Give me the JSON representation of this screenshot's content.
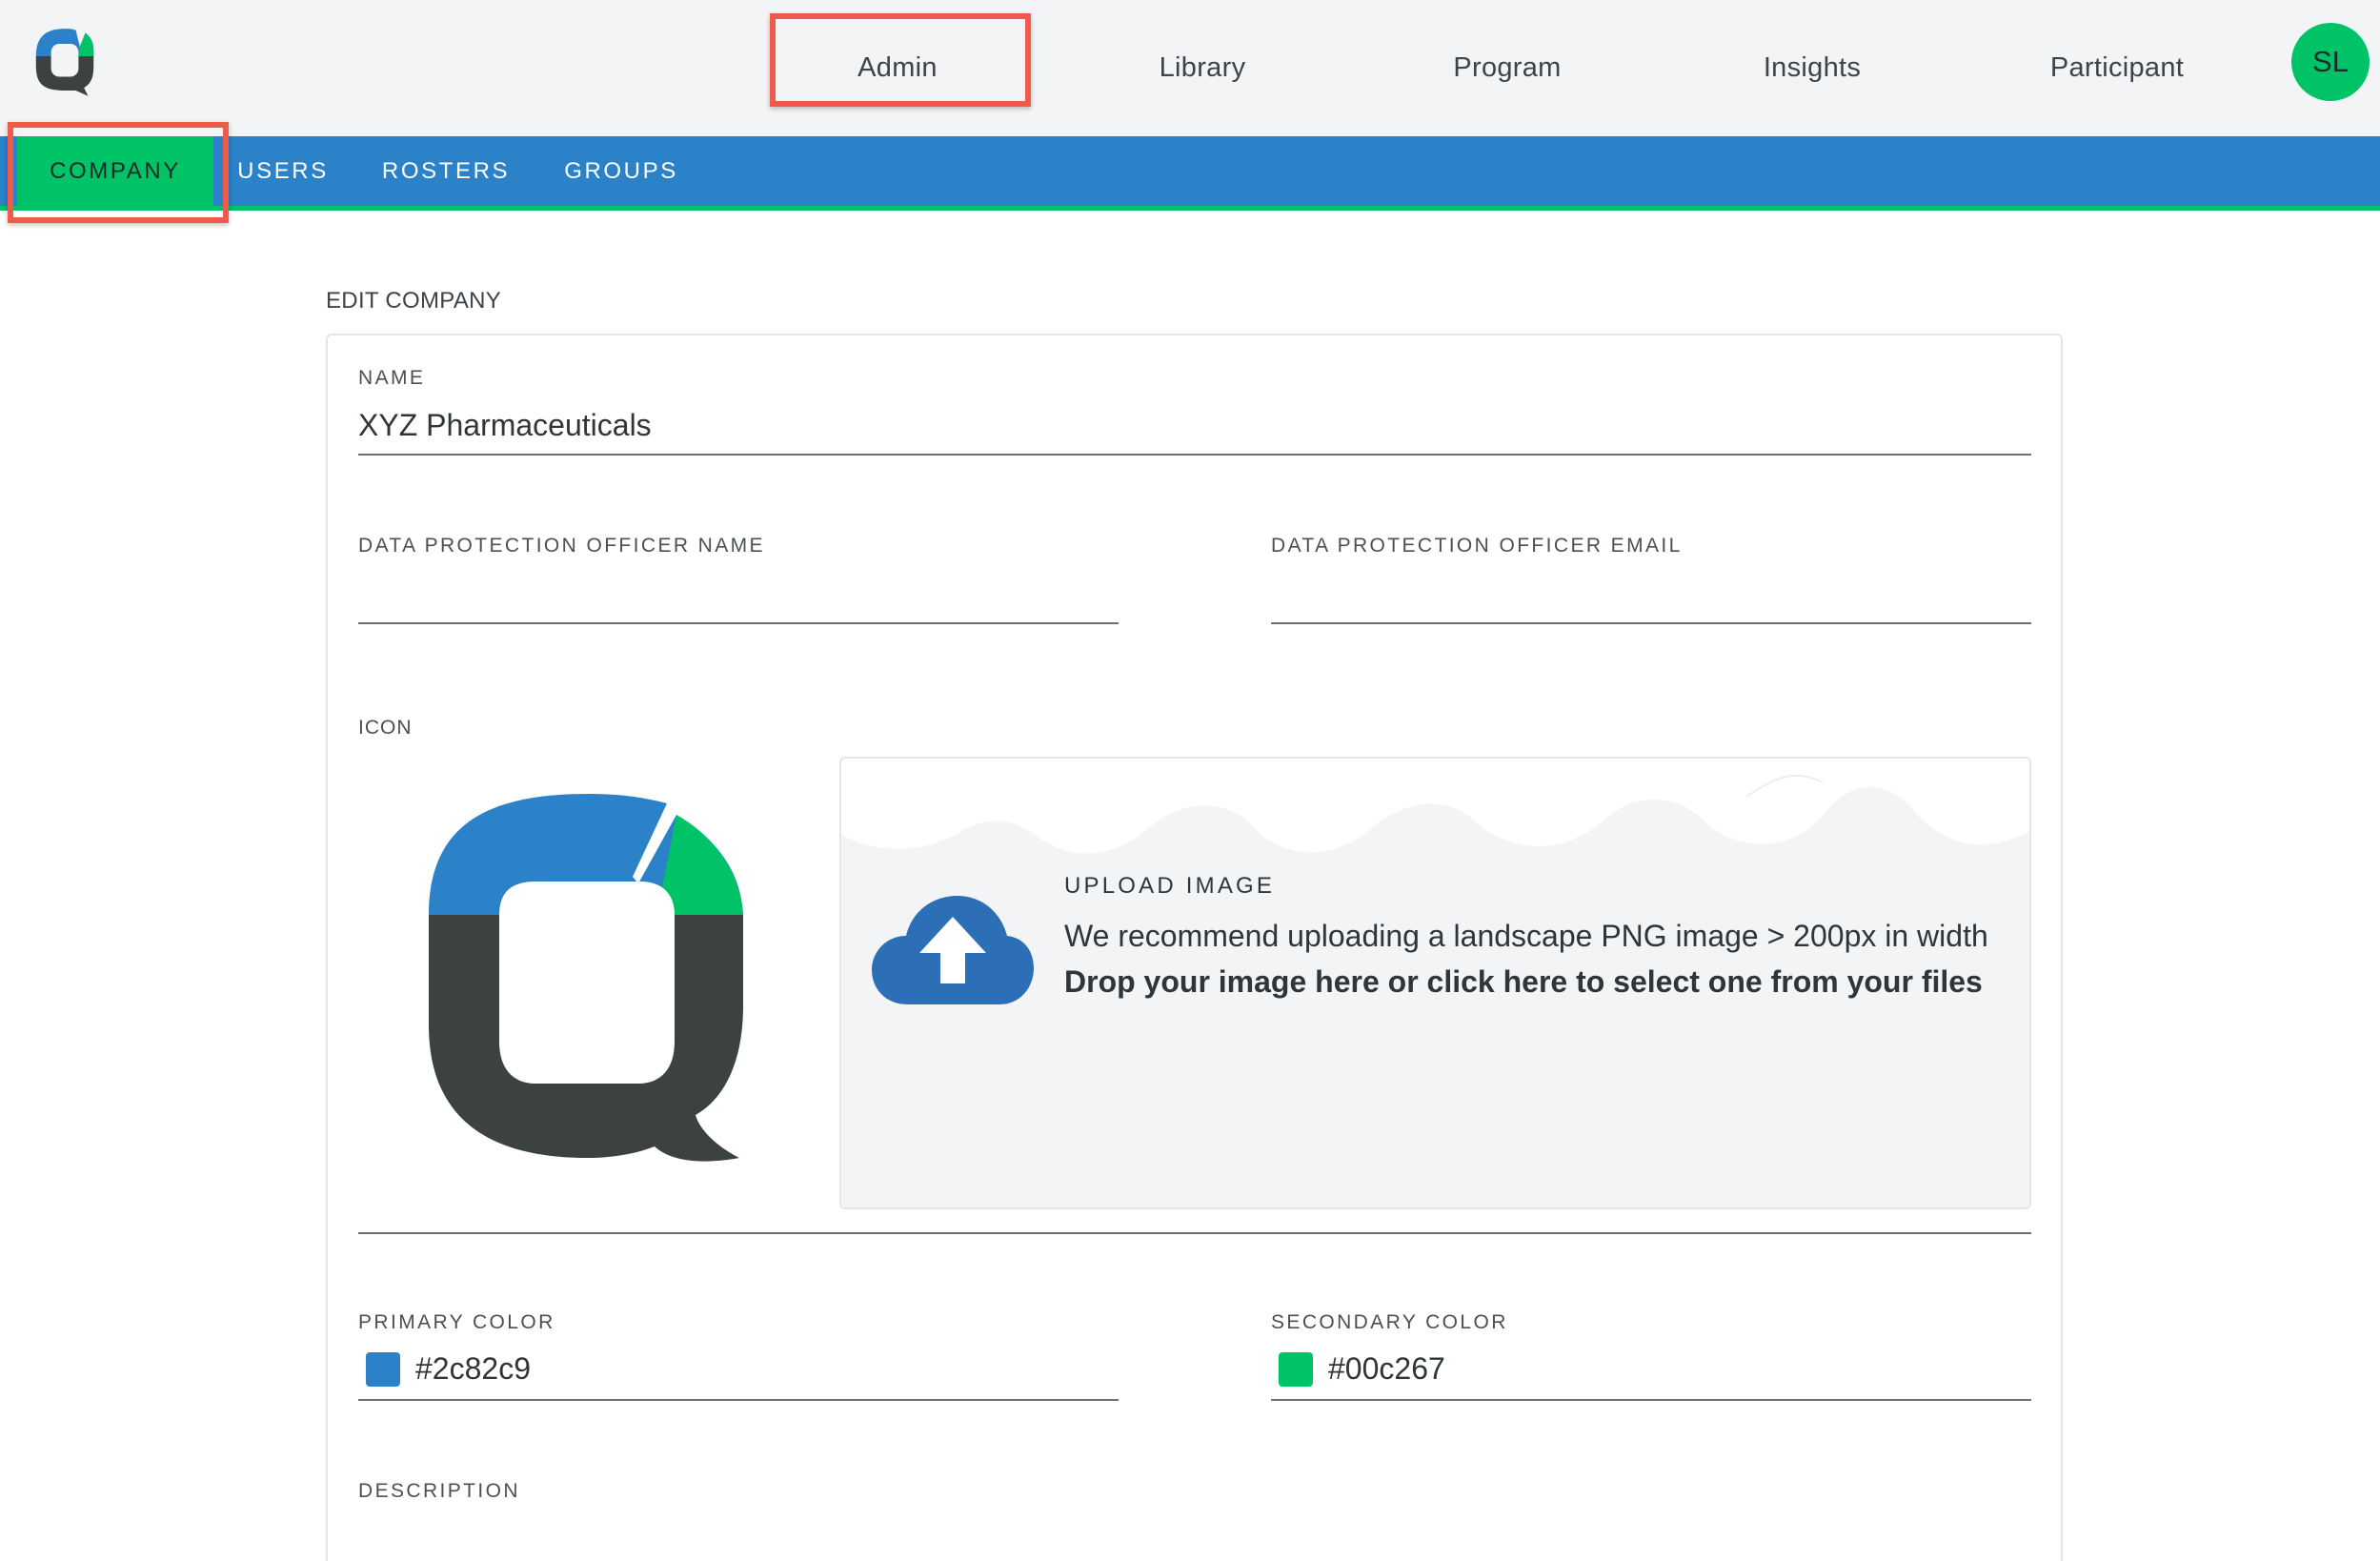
{
  "topnav": {
    "items": [
      {
        "label": "Admin"
      },
      {
        "label": "Library"
      },
      {
        "label": "Program"
      },
      {
        "label": "Insights"
      },
      {
        "label": "Participant"
      }
    ],
    "avatar_initials": "SL",
    "logo_icon": "q-logo-icon"
  },
  "subnav": {
    "items": [
      {
        "label": "COMPANY",
        "active": true
      },
      {
        "label": "USERS"
      },
      {
        "label": "ROSTERS"
      },
      {
        "label": "GROUPS"
      }
    ]
  },
  "page": {
    "title": "EDIT COMPANY"
  },
  "form": {
    "name": {
      "label": "NAME",
      "value": "XYZ Pharmaceuticals"
    },
    "dpo_name": {
      "label": "DATA PROTECTION OFFICER NAME",
      "value": ""
    },
    "dpo_email": {
      "label": "DATA PROTECTION OFFICER EMAIL",
      "value": ""
    },
    "icon": {
      "label": "ICON"
    },
    "upload": {
      "title": "UPLOAD IMAGE",
      "hint": "We recommend uploading a landscape PNG image > 200px in width",
      "cta": "Drop your image here or click here to select one from your files",
      "icon": "cloud-upload-icon"
    },
    "primary_color": {
      "label": "PRIMARY COLOR",
      "value": "#2c82c9"
    },
    "secondary_color": {
      "label": "SECONDARY COLOR",
      "value": "#00c267"
    },
    "description": {
      "label": "DESCRIPTION"
    }
  },
  "colors": {
    "brand_blue": "#2c82c9",
    "brand_green": "#00c267",
    "brand_dark": "#3c4240",
    "highlight": "#f05a4a"
  }
}
